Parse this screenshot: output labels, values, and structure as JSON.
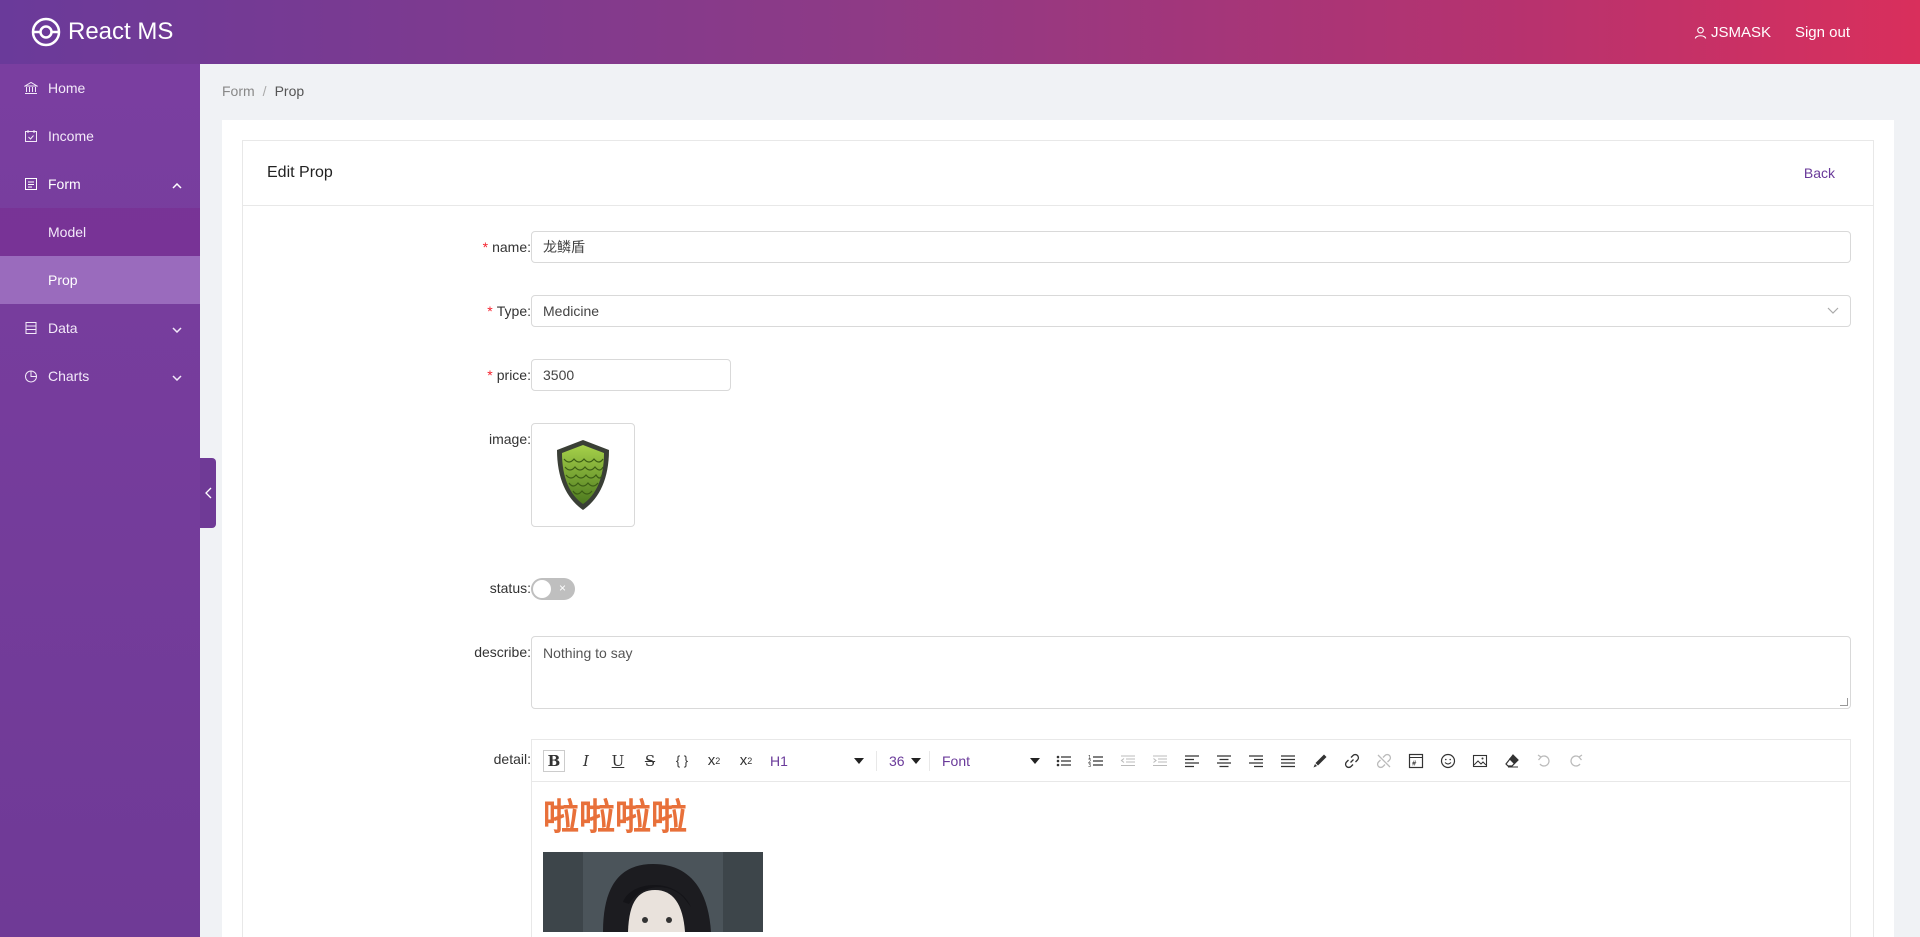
{
  "app": {
    "title": "React MS"
  },
  "header": {
    "username": "JSMASK",
    "signout_label": "Sign out"
  },
  "sidebar": {
    "items": [
      {
        "label": "Home",
        "icon": "bank-icon"
      },
      {
        "label": "Income",
        "icon": "calendar-check-icon"
      },
      {
        "label": "Form",
        "icon": "form-icon",
        "open": true,
        "children": [
          {
            "label": "Model"
          },
          {
            "label": "Prop",
            "active": true
          }
        ]
      },
      {
        "label": "Data",
        "icon": "database-icon"
      },
      {
        "label": "Charts",
        "icon": "pie-chart-icon"
      }
    ]
  },
  "breadcrumb": {
    "parent": "Form",
    "current": "Prop"
  },
  "card": {
    "title": "Edit Prop",
    "back_label": "Back"
  },
  "form": {
    "name": {
      "label": "name",
      "value": "龙鳞盾"
    },
    "type": {
      "label": "Type",
      "value": "Medicine"
    },
    "price": {
      "label": "price",
      "value": "3500"
    },
    "image": {
      "label": "image",
      "icon": "dragon-scale-shield-image"
    },
    "status": {
      "label": "status",
      "checked": false,
      "off_symbol": "×"
    },
    "describe": {
      "label": "describe",
      "value": "Nothing to say"
    },
    "detail": {
      "label": "detail",
      "toolbar": {
        "heading": "H1",
        "size": "36",
        "font": "Font"
      },
      "content_heading": "啦啦啦啦",
      "heading_color": "#e8703a"
    }
  },
  "colors": {
    "accent": "#6a3a9a",
    "header_start": "#6a3a9a",
    "header_end": "#d92f5c",
    "required": "#f5222d"
  }
}
